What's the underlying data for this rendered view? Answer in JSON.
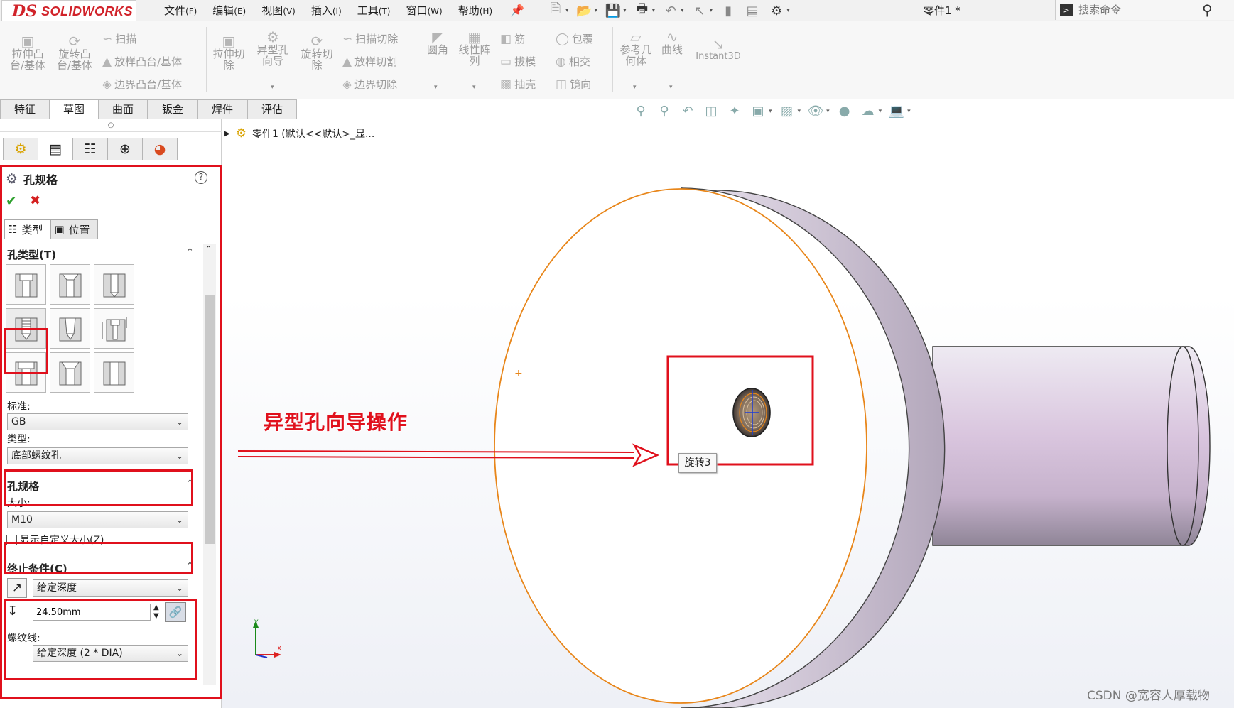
{
  "app": {
    "logo_ds": "DS",
    "logo_text": "SOLIDWORKS",
    "doc_title": "零件1 *"
  },
  "menus": [
    {
      "label": "文件",
      "key": "(F)"
    },
    {
      "label": "编辑",
      "key": "(E)"
    },
    {
      "label": "视图",
      "key": "(V)"
    },
    {
      "label": "插入",
      "key": "(I)"
    },
    {
      "label": "工具",
      "key": "(T)"
    },
    {
      "label": "窗口",
      "key": "(W)"
    },
    {
      "label": "帮助",
      "key": "(H)"
    }
  ],
  "search": {
    "placeholder": "搜索命令"
  },
  "command_manager": {
    "extrude_boss": "拉伸凸台/基体",
    "revolve_boss": "旋转凸台/基体",
    "sweep": "扫描",
    "loft_boss": "放样凸台/基体",
    "boundary_boss": "边界凸台/基体",
    "extrude_cut": "拉伸切除",
    "hole_wizard": "异型孔向导",
    "revolve_cut": "旋转切除",
    "sweep_cut": "扫描切除",
    "loft_cut": "放样切割",
    "boundary_cut": "边界切除",
    "fillet": "圆角",
    "linear_pattern": "线性阵列",
    "rib": "筋",
    "draft": "拔模",
    "shell": "抽壳",
    "wrap": "包覆",
    "intersect": "相交",
    "mirror": "镜向",
    "ref_geometry": "参考几何体",
    "curves": "曲线",
    "instant3d": "Instant3D"
  },
  "tabs": [
    "特征",
    "草图",
    "曲面",
    "钣金",
    "焊件",
    "评估"
  ],
  "property_manager": {
    "title": "孔规格",
    "help": "?",
    "tab_type": "类型",
    "tab_position": "位置",
    "hole_type_group": "孔类型(T)",
    "standard_label": "标准:",
    "standard_value": "GB",
    "type_label": "类型:",
    "type_value": "底部螺纹孔",
    "spec_group": "孔规格",
    "size_label": "大小:",
    "size_value": "M10",
    "custom_size_label": "显示自定义大小(Z)",
    "custom_size_checked": false,
    "end_condition_group": "终止条件(C)",
    "end_condition_value": "给定深度",
    "depth_value": "24.50mm",
    "thread_label": "螺纹线:",
    "thread_value": "给定深度 (2 * DIA)"
  },
  "feature_tree": {
    "part_label": "零件1 (默认<<默认>_显..."
  },
  "viewport": {
    "annotation": "异型孔向导操作",
    "tooltip": "旋转3",
    "triad_y": "Y",
    "triad_x": "X"
  },
  "watermark": "CSDN @宽容人厚载物",
  "colors": {
    "accent_red": "#e0101c",
    "edge_orange": "#e8861a",
    "ok_green": "#2da02d",
    "brand_red": "#d1232a"
  }
}
